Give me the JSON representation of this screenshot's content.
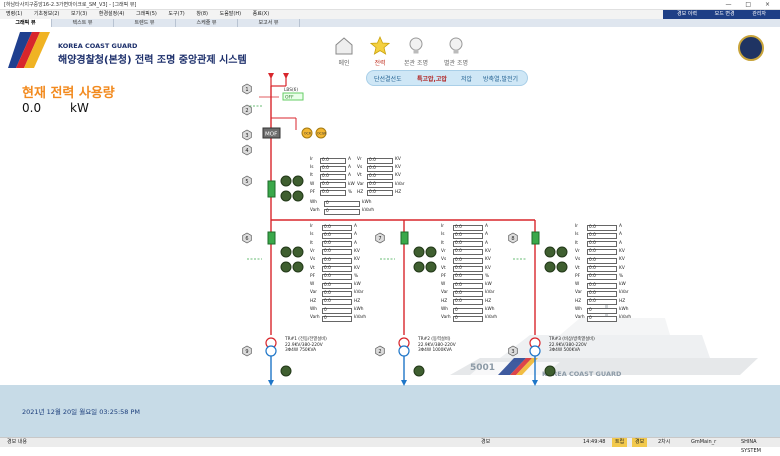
{
  "window": {
    "title": "[하남타사지구중앙16-2.3가변마이크로_SM_V3] - [그래픽 뷰]",
    "controls": "— □ ×"
  },
  "menu": {
    "items": [
      "명령(1)",
      "기초정보(2)",
      "보기(3)",
      "환경설정(4)",
      "그래픽(5)",
      "도구(7)",
      "창(8)",
      "도움말(H)",
      "종료(X)"
    ],
    "right_items": [
      "경보 이력",
      "모드 변경",
      "관리자"
    ]
  },
  "tabs": [
    "그래픽 뷰",
    "텍스트 뷰",
    "트렌드 뷰",
    "스케줄 뷰",
    "보고서 뷰"
  ],
  "header": {
    "coast_guard": "KOREA COAST GUARD",
    "title": "해양경찰청(본청) 전력 조명 중앙관제 시스템",
    "nav": [
      {
        "label": "메인",
        "icon": "home-icon"
      },
      {
        "label": "전력",
        "icon": "star-icon"
      },
      {
        "label": "본관 조명",
        "icon": "bulb-icon"
      },
      {
        "label": "별관 조명",
        "icon": "bulb-icon"
      }
    ]
  },
  "subtabs": [
    "단선결선도",
    "특고압,고압",
    "저압",
    "방축열,발전기"
  ],
  "power": {
    "label": "현재 전력 사용량",
    "value": "0.0",
    "unit": "kW"
  },
  "diagram": {
    "lbs_label": "LBS(6)",
    "lbs_state": "OFF",
    "mof_label": "MOF",
    "breaker_labels": [
      "1",
      "2",
      "3",
      "4",
      "5",
      "6",
      "7",
      "8",
      "9"
    ],
    "status_labels": [
      "OCR",
      "OCGR"
    ],
    "main_meter": {
      "left": [
        {
          "k": "Ir",
          "v": "0.0",
          "u": "A"
        },
        {
          "k": "Is",
          "v": "0.0",
          "u": "A"
        },
        {
          "k": "It",
          "v": "0.0",
          "u": "A"
        },
        {
          "k": "W",
          "v": "0.0",
          "u": "kW"
        },
        {
          "k": "PF",
          "v": "0.0",
          "u": "%"
        }
      ],
      "right": [
        {
          "k": "Vr",
          "v": "0.0",
          "u": "KV"
        },
        {
          "k": "Vs",
          "v": "0.0",
          "u": "KV"
        },
        {
          "k": "Vt",
          "v": "0.0",
          "u": "KV"
        },
        {
          "k": "Var",
          "v": "0.0",
          "u": "kVar"
        },
        {
          "k": "HZ",
          "v": "0.0",
          "u": "HZ"
        }
      ],
      "bottom": [
        {
          "k": "Wh",
          "v": "0",
          "u": "kWh"
        },
        {
          "k": "Varh",
          "v": "0",
          "u": "kVarh"
        }
      ]
    },
    "feeder_rows": [
      {
        "k": "Ir",
        "v": "0.0",
        "u": "A"
      },
      {
        "k": "Is",
        "v": "0.0",
        "u": "A"
      },
      {
        "k": "It",
        "v": "0.0",
        "u": "A"
      },
      {
        "k": "Vr",
        "v": "0.0",
        "u": "KV"
      },
      {
        "k": "Vs",
        "v": "0.0",
        "u": "KV"
      },
      {
        "k": "Vt",
        "v": "0.0",
        "u": "KV"
      },
      {
        "k": "PF",
        "v": "0.0",
        "u": "%"
      },
      {
        "k": "W",
        "v": "0.0",
        "u": "kW"
      },
      {
        "k": "Var",
        "v": "0.0",
        "u": "kVar"
      },
      {
        "k": "HZ",
        "v": "0.0",
        "u": "HZ"
      },
      {
        "k": "Wh",
        "v": "0",
        "u": "kWh"
      },
      {
        "k": "Varh",
        "v": "0",
        "u": "kVarh"
      }
    ],
    "transformers": [
      {
        "name": "TR#1 (전등/전열설비)",
        "spec1": "22.9KV/380-220V",
        "spec2": "3Φ4W 750KVA"
      },
      {
        "name": "TR#2 (동력설비)",
        "spec1": "22.9KV/380-220V",
        "spec2": "3Φ4W 1000KVA"
      },
      {
        "name": "TR#3 (비상/방축열설비)",
        "spec1": "22.9KV/380-220V",
        "spec2": "3Φ4W 500KVA"
      }
    ],
    "ship_number": "5001",
    "ship_text": "KOREA COAST GUARD"
  },
  "datetime": "2021년 12월 20일 월요일 03:25:58 PM",
  "status": {
    "left": "경보 내용",
    "segments": [
      "경보",
      "14:49:48",
      "트립",
      "경보",
      "2차시",
      "GmMain_r",
      "SHINA SYSTEM"
    ]
  }
}
